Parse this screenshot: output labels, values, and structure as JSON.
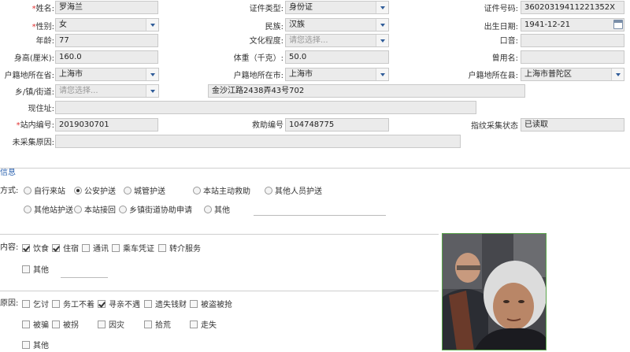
{
  "form": {
    "name": {
      "label": "姓名:",
      "value": "罗海兰"
    },
    "id_type": {
      "label": "证件类型:",
      "value": "身份证"
    },
    "id_number": {
      "label": "证件号码:",
      "value": "36020319411221352X"
    },
    "gender": {
      "label": "性别:",
      "value": "女"
    },
    "ethnicity": {
      "label": "民族:",
      "value": "汉族"
    },
    "birth_date": {
      "label": "出生日期:",
      "value": "1941-12-21"
    },
    "age": {
      "label": "年龄:",
      "value": "77"
    },
    "education": {
      "label": "文化程度:",
      "placeholder": "请您选择..."
    },
    "accent": {
      "label": "口音:",
      "value": ""
    },
    "height": {
      "label": "身高(厘米):",
      "value": "160.0"
    },
    "weight": {
      "label": "体重（千克）:",
      "value": "50.0"
    },
    "alias": {
      "label": "曾用名:",
      "value": ""
    },
    "hukou_province": {
      "label": "户籍地所在省:",
      "value": "上海市"
    },
    "hukou_city": {
      "label": "户籍地所在市:",
      "value": "上海市"
    },
    "hukou_county": {
      "label": "户籍地所在县:",
      "value": "上海市普陀区"
    },
    "hukou_township": {
      "label": "乡/镇/街道:",
      "placeholder": "请您选择...",
      "address": "金沙江路2438弄43号702"
    },
    "current_address": {
      "label": "现住址:",
      "value": ""
    },
    "station_no": {
      "label": "站内编号:",
      "value": "2019030701"
    },
    "rescue_no": {
      "label": "救助编号",
      "value": "104748775"
    },
    "fingerprint": {
      "label": "指纹采集状态",
      "value": "已读取"
    },
    "not_collected_reason": {
      "label": "未采集原因:",
      "value": ""
    }
  },
  "section_title": "信息",
  "arrival": {
    "label": "方式:",
    "row1": [
      {
        "label": "自行来站",
        "checked": false
      },
      {
        "label": "公安护送",
        "checked": true
      },
      {
        "label": "城管护送",
        "checked": false
      },
      {
        "label": "本站主动救助",
        "checked": false
      },
      {
        "label": "其他人员护送",
        "checked": false
      }
    ],
    "row2": [
      {
        "label": "其他站护送",
        "checked": false
      },
      {
        "label": "本站接回",
        "checked": false
      },
      {
        "label": "乡镇街道协助申请",
        "checked": false
      },
      {
        "label": "其他",
        "checked": false
      }
    ]
  },
  "content": {
    "label": "内容:",
    "row1": [
      {
        "label": "饮食",
        "checked": true
      },
      {
        "label": "住宿",
        "checked": true
      },
      {
        "label": "通讯",
        "checked": false
      },
      {
        "label": "乘车凭证",
        "checked": false
      },
      {
        "label": "转介服务",
        "checked": false
      }
    ],
    "other": {
      "label": "其他",
      "checked": false
    }
  },
  "reason": {
    "label": "原因:",
    "row1": [
      {
        "label": "乞讨",
        "checked": false
      },
      {
        "label": "务工不着",
        "checked": false
      },
      {
        "label": "寻亲不遇",
        "checked": true
      },
      {
        "label": "遗失钱财",
        "checked": false
      },
      {
        "label": "被盗被抢",
        "checked": false
      }
    ],
    "row2": [
      {
        "label": "被骗",
        "checked": false
      },
      {
        "label": "被拐",
        "checked": false
      },
      {
        "label": "因灾",
        "checked": false
      },
      {
        "label": "拾荒",
        "checked": false
      },
      {
        "label": "走失",
        "checked": false
      }
    ],
    "other": {
      "label": "其他",
      "checked": false
    }
  },
  "colors": {
    "accent": "#2e64b0",
    "required": "#e03030",
    "field_bg": "#ebebeb",
    "photo_border": "#5aa54a"
  }
}
